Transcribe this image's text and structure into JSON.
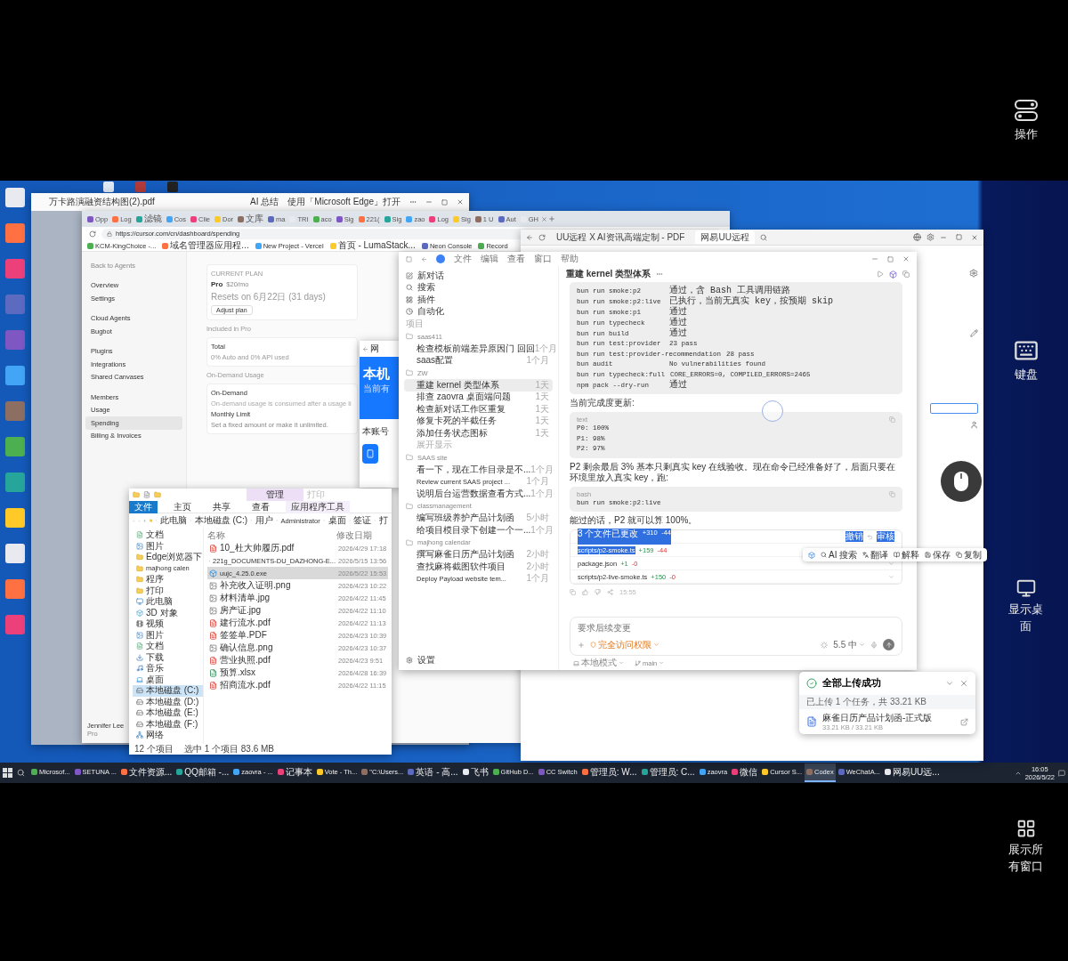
{
  "remote_panel": {
    "buttons": [
      {
        "label": "操作",
        "kind": "toggle"
      },
      {
        "label": "键盘",
        "kind": "keyboard"
      },
      {
        "label": "显示桌面",
        "kind": "desktop"
      },
      {
        "label": "展示所有窗口",
        "kind": "windows"
      }
    ]
  },
  "pdf_window": {
    "title": "万卡路演融资结构图(2).pdf",
    "actions": [
      "AI 总结",
      "使用「Microsoft Edge」打开"
    ]
  },
  "browser": {
    "tabs": [
      "Opp",
      "Log",
      "滤镜",
      "Cos",
      "Clie",
      "Dor",
      "文库",
      "ma",
      "TRI",
      "aco",
      "Sig",
      "221(",
      "Sig",
      "zao",
      "Log",
      "Sig",
      "1 U",
      "Aut",
      "GH"
    ],
    "url": "https://cursor.com/cn/dashboard/spending",
    "bookmarks": [
      "KCM-KingChoice -...",
      "域名管理器应用程...",
      "New Project - Vercel",
      "首页 - LumaStack...",
      "Neon Console",
      "Record"
    ],
    "sidebar": {
      "back": "Back to Agents",
      "groups": [
        [
          {
            "label": "Overview",
            "selected": false
          },
          {
            "label": "Settings",
            "selected": false
          }
        ],
        [
          {
            "label": "Cloud Agents",
            "selected": false
          },
          {
            "label": "Bugbot",
            "selected": false
          }
        ],
        [
          {
            "label": "Plugins",
            "selected": false
          },
          {
            "label": "Integrations",
            "selected": false
          },
          {
            "label": "Shared Canvases",
            "selected": false
          }
        ],
        [
          {
            "label": "Members",
            "selected": false
          },
          {
            "label": "Usage",
            "selected": false
          },
          {
            "label": "Spending",
            "selected": true
          },
          {
            "label": "Billing & Invoices",
            "selected": false
          }
        ]
      ]
    },
    "user": {
      "name": "Jennifer Lee",
      "plan": "Pro"
    },
    "plan": {
      "heading": "CURRENT PLAN",
      "name": "Pro",
      "price": "$20/mo",
      "resets": "Resets on 6月22日 (31 days)",
      "button": "Adjust plan"
    },
    "included": {
      "heading": "Included in Pro",
      "total": "Total",
      "usage": "0% Auto and 0% API used"
    },
    "on_demand": {
      "heading": "On-Demand Usage",
      "title": "On-Demand",
      "desc": "On-demand usage is consumed after a usage li",
      "limit_title": "Monthly Limit",
      "limit_desc": "Set a fixed amount or make it unlimited."
    }
  },
  "phone_window": {
    "title": "网",
    "hero": "本机",
    "hero_sub": "当前有",
    "account": "本账号"
  },
  "uu_window": {
    "tabs": [
      {
        "label": "UU远程 X AI资讯高端定制 - PDF",
        "selected": false
      },
      {
        "label": "网易UU远程",
        "selected": true
      }
    ]
  },
  "explorer": {
    "context_tab": "管理",
    "title": "打印",
    "ribbon": [
      {
        "label": "文件",
        "selected": true
      },
      {
        "label": "主页",
        "selected": false
      },
      {
        "label": "共享",
        "selected": false
      },
      {
        "label": "查看",
        "selected": false
      },
      {
        "label": "应用程序工具",
        "selected": false
      }
    ],
    "path": [
      "此电脑",
      "本地磁盘 (C:)",
      "用户",
      "Administrator",
      "桌面",
      "签证",
      "打"
    ],
    "nav": [
      {
        "label": "文档",
        "kind": "doc",
        "selected": false
      },
      {
        "label": "图片",
        "kind": "image",
        "selected": false
      },
      {
        "label": "Edge浏览器下",
        "kind": "folder",
        "selected": false
      },
      {
        "label": "majhong calen",
        "kind": "folder",
        "selected": false
      },
      {
        "label": "程序",
        "kind": "folder",
        "selected": false
      },
      {
        "label": "打印",
        "kind": "folder",
        "selected": false
      },
      {
        "label": "此电脑",
        "kind": "pc",
        "selected": false
      },
      {
        "label": "3D 对象",
        "kind": "object3d",
        "selected": false
      },
      {
        "label": "视频",
        "kind": "video",
        "selected": false
      },
      {
        "label": "图片",
        "kind": "image",
        "selected": false
      },
      {
        "label": "文档",
        "kind": "doc",
        "selected": false
      },
      {
        "label": "下载",
        "kind": "download",
        "selected": false
      },
      {
        "label": "音乐",
        "kind": "music",
        "selected": false
      },
      {
        "label": "桌面",
        "kind": "desktop",
        "selected": false
      },
      {
        "label": "本地磁盘 (C:)",
        "kind": "drive",
        "selected": true
      },
      {
        "label": "本地磁盘 (D:)",
        "kind": "drive",
        "selected": false
      },
      {
        "label": "本地磁盘 (E:)",
        "kind": "drive",
        "selected": false
      },
      {
        "label": "本地磁盘 (F:)",
        "kind": "drive",
        "selected": false
      },
      {
        "label": "网络",
        "kind": "network",
        "selected": false
      }
    ],
    "columns": [
      "名称",
      "修改日期"
    ],
    "files": [
      {
        "name": "10_杜大帅履历.pdf",
        "date": "2026/4/29 17:18",
        "kind": "pdf",
        "selected": false
      },
      {
        "name": "221g_DOCUMENTS-DU_DAZHONG-E...",
        "date": "2026/5/15 13:56",
        "kind": "pdf",
        "selected": false
      },
      {
        "name": "uujc_4.25.0.exe",
        "date": "2026/5/22 15:53",
        "kind": "exe",
        "selected": true
      },
      {
        "name": "补充收入证明.png",
        "date": "2026/4/23 10:22",
        "kind": "image",
        "selected": false
      },
      {
        "name": "材料清单.jpg",
        "date": "2026/4/22 11:45",
        "kind": "image",
        "selected": false
      },
      {
        "name": "房产证.jpg",
        "date": "2026/4/22 11:10",
        "kind": "image",
        "selected": false
      },
      {
        "name": "建行流水.pdf",
        "date": "2026/4/22 11:13",
        "kind": "pdf",
        "selected": false
      },
      {
        "name": "签签单.PDF",
        "date": "2026/4/23 10:39",
        "kind": "pdf",
        "selected": false
      },
      {
        "name": "确认信息.png",
        "date": "2026/4/23 10:37",
        "kind": "image",
        "selected": false
      },
      {
        "name": "营业执照.pdf",
        "date": "2026/4/23 9:51",
        "kind": "pdf",
        "selected": false
      },
      {
        "name": "预算.xlsx",
        "date": "2026/4/28 16:39",
        "kind": "xlsx",
        "selected": false
      },
      {
        "name": "招商流水.pdf",
        "date": "2026/4/22 11:15",
        "kind": "pdf",
        "selected": false
      }
    ],
    "status": [
      "12 个项目",
      "选中 1 个项目 83.6 MB"
    ]
  },
  "codex": {
    "menu": [
      "文件",
      "编辑",
      "查看",
      "窗口",
      "帮助"
    ],
    "nav": [
      {
        "label": "新对话",
        "kind": "new"
      },
      {
        "label": "搜索",
        "kind": "search"
      },
      {
        "label": "插件",
        "kind": "plugins"
      },
      {
        "label": "自动化",
        "kind": "automation"
      }
    ],
    "projects_label": "项目",
    "projects": [
      {
        "name": "saas411",
        "threads": [
          {
            "title": "检查模板前端差异原因门 回回",
            "age": "1个月",
            "selected": false
          },
          {
            "title": "saas配置",
            "age": "1个月",
            "selected": false
          }
        ]
      },
      {
        "name": "ZW",
        "threads": [
          {
            "title": "重建 kernel 类型体系",
            "age": "1天",
            "selected": true
          },
          {
            "title": "排查 zaovra 桌面端问题",
            "age": "1天",
            "selected": false
          },
          {
            "title": "检查新对话工作区重复",
            "age": "1天",
            "selected": false
          },
          {
            "title": "修复卡死的半截任务",
            "age": "1天",
            "selected": false
          },
          {
            "title": "添加任务状态图标",
            "age": "1天",
            "selected": false
          }
        ],
        "more": "展开显示"
      },
      {
        "name": "SAAS site",
        "threads": [
          {
            "title": "看一下，现在工作目录是不...",
            "age": "1个月",
            "selected": false
          },
          {
            "title": "Review current SAAS project ...",
            "age": "1个月",
            "selected": false
          },
          {
            "title": "说明后台运营数据查看方式...",
            "age": "1个月",
            "selected": false
          }
        ]
      },
      {
        "name": "classmanagement",
        "threads": [
          {
            "title": "编写班级养护产品计划函",
            "age": "5小时",
            "selected": false
          },
          {
            "title": "给项目模目录下创建一个一...",
            "age": "1个月",
            "selected": false
          }
        ]
      },
      {
        "name": "majhong calendar",
        "threads": [
          {
            "title": "撰写麻雀日历产品计划函",
            "age": "2小时",
            "selected": false
          },
          {
            "title": "查找麻将截图软件项目",
            "age": "2小时",
            "selected": false
          },
          {
            "title": "Deploy Payload website tem...",
            "age": "1个月",
            "selected": false
          }
        ]
      }
    ],
    "settings": "设置",
    "thread_title": "重建 kernel 类型体系",
    "results": [
      {
        "command": "bun run smoke:p2",
        "result": "通过，含 Bash 工具调用链路"
      },
      {
        "command": "bun run smoke:p2:live",
        "result": "已执行，当前无真实 key，按预期 skip"
      },
      {
        "command": "bun run smoke:p1",
        "result": "通过"
      },
      {
        "command": "bun run typecheck",
        "result": "通过"
      },
      {
        "command": "bun run build",
        "result": "通过"
      },
      {
        "command": "bun run test:provider",
        "result": "23 pass"
      },
      {
        "command": "bun run test:provider-recommendation",
        "result": "28 pass"
      },
      {
        "command": "bun audit",
        "result": "No vulnerabilities found"
      },
      {
        "command": "bun run typecheck:full",
        "result": "CORE_ERRORS=0, COMPILED_ERRORS=2465"
      },
      {
        "command": "npm pack --dry-run",
        "result": "通过"
      }
    ],
    "progress_heading": "当前完成度更新:",
    "progress_block": {
      "lang": "text",
      "lines": [
        "P0: 100%",
        "P1: 98%",
        "P2: 97%"
      ]
    },
    "note": "P2 剩余最后 3% 基本只剩真实 key 在线验收。现在命令已经准备好了，后面只要在环境里放入真实 key，跑:",
    "bash_block": {
      "lang": "bash",
      "lines": [
        "bun run smoke:p2:live"
      ]
    },
    "closing": "能过的话，P2 就可以算 100%。",
    "changes": {
      "summary": "3 个文件已更改",
      "added": "+310",
      "removed": "-44",
      "undo": "撤销",
      "review": "审核",
      "highlighted": true,
      "files": [
        {
          "path": "scripts/p2-smoke.ts",
          "added": "+159",
          "removed": "-44",
          "highlighted": true
        },
        {
          "path": "package.json",
          "added": "+1",
          "removed": "-0",
          "highlighted": false
        },
        {
          "path": "scripts/p2-live-smoke.ts",
          "added": "+150",
          "removed": "-0",
          "highlighted": false
        }
      ]
    },
    "time": "15:55",
    "composer": {
      "placeholder": "要求后续变更",
      "access": "完全访问权限",
      "model": "5.5 中",
      "mode": "本地模式",
      "branch": "main"
    }
  },
  "selection_toolbar": [
    "AI 搜索",
    "翻译",
    "解释",
    "保存",
    "复制"
  ],
  "notification": {
    "title": "全部上传成功",
    "summary": "已上传 1 个任务，共 33.21 KB",
    "file": "麻雀日历产品计划函-正式版",
    "size": "33.21 KB / 33.21 KB"
  },
  "taskbar": {
    "items": [
      {
        "label": "Microsof...",
        "selected": false
      },
      {
        "label": "SETUNA ...",
        "selected": false
      },
      {
        "label": "文件资源...",
        "selected": false
      },
      {
        "label": "QQ邮箱 -...",
        "selected": false
      },
      {
        "label": "zaovra - ...",
        "selected": false
      },
      {
        "label": "记事本",
        "selected": false
      },
      {
        "label": "Vote - Th...",
        "selected": false
      },
      {
        "label": "\"C:\\Users...",
        "selected": false
      },
      {
        "label": "英语 - 高...",
        "selected": false
      },
      {
        "label": "飞书",
        "selected": false
      },
      {
        "label": "GitHub D...",
        "selected": false
      },
      {
        "label": "CC Switch",
        "selected": false
      },
      {
        "label": "管理员: W...",
        "selected": false
      },
      {
        "label": "管理员: C...",
        "selected": false
      },
      {
        "label": "zaovra",
        "selected": false
      },
      {
        "label": "微信",
        "selected": false
      },
      {
        "label": "Cursor S...",
        "selected": false
      },
      {
        "label": "Codex",
        "selected": true
      },
      {
        "label": "WeChatA...",
        "selected": false
      },
      {
        "label": "网易UU远...",
        "selected": false
      }
    ],
    "time": "16:05",
    "date": "2026/5/22"
  }
}
